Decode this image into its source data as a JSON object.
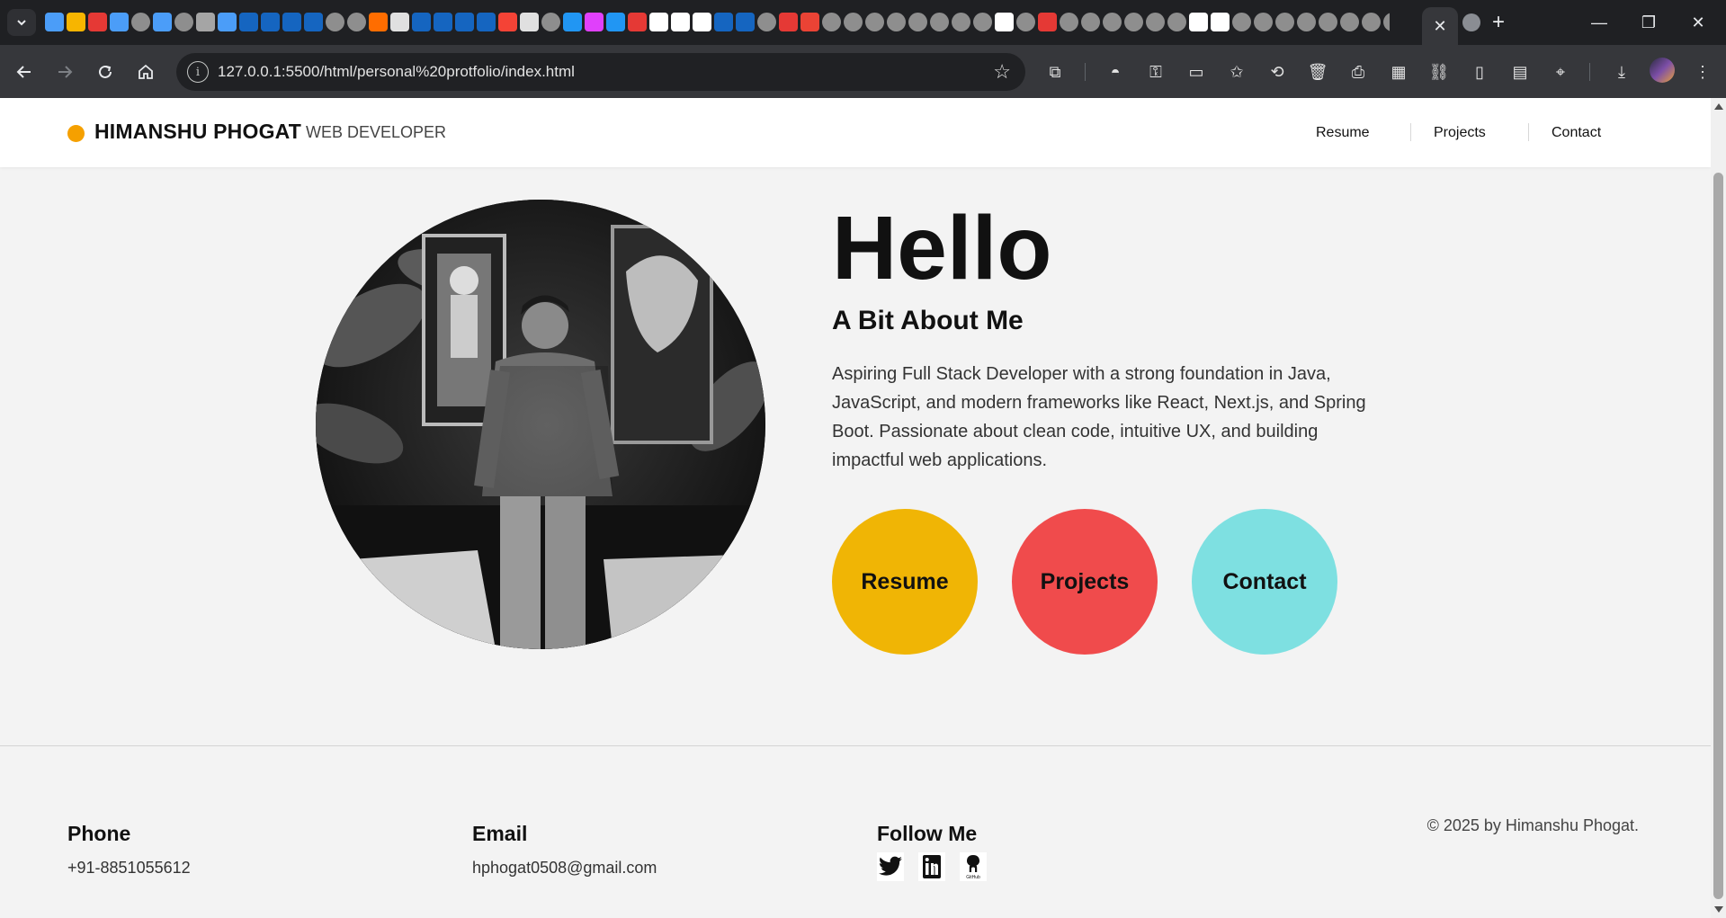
{
  "browser": {
    "tab_search_icon": "chevron-down",
    "active_tab_close": "✕",
    "new_tab": "+",
    "window": {
      "minimize": "—",
      "restore": "❐",
      "close": "✕"
    },
    "favicon_colors": [
      "#4b9df8",
      "#f7b500",
      "#e53935",
      "#4b9df8",
      "#8e8e8e",
      "#4b9df8",
      "#8e8e8e",
      "#a5a5a5",
      "#4b9df8",
      "#1565c0",
      "#1565c0",
      "#1565c0",
      "#1565c0",
      "#8e8e8e",
      "#8e8e8e",
      "#ff6d00",
      "#e0e0e0",
      "#1565c0",
      "#1565c0",
      "#1565c0",
      "#1565c0",
      "#f44336",
      "#e0e0e0",
      "#8e8e8e",
      "#2196f3",
      "#e040fb",
      "#2196f3",
      "#e53935",
      "#ffffff",
      "#ffffff",
      "#ffffff",
      "#1565c0",
      "#1565c0",
      "#8e8e8e",
      "#e53935",
      "#ea4335",
      "#8e8e8e",
      "#8e8e8e",
      "#8e8e8e",
      "#8e8e8e",
      "#8e8e8e",
      "#8e8e8e",
      "#8e8e8e",
      "#8e8e8e",
      "#ffffff",
      "#8e8e8e",
      "#e53935",
      "#8e8e8e",
      "#8e8e8e",
      "#8e8e8e",
      "#8e8e8e",
      "#8e8e8e",
      "#8e8e8e",
      "#ffffff",
      "#ffffff",
      "#8e8e8e",
      "#8e8e8e",
      "#8e8e8e",
      "#8e8e8e",
      "#8e8e8e",
      "#8e8e8e",
      "#8e8e8e",
      "#8e8e8e",
      "#8e8e8e",
      "#8e8e8e",
      "#8e8e8e",
      "#8e8e8e",
      "#8e8e8e",
      "#8e8e8e",
      "#1565c0",
      "#1565c0",
      "#e0e0e0",
      "#8e8e8e",
      "#ff7043",
      "#ff5722",
      "#ff7043",
      "#26a69a",
      "#8e8e8e"
    ],
    "address": {
      "url": "127.0.0.1:5500/html/personal%20protfolio/index.html"
    }
  },
  "site": {
    "header": {
      "brand_dot_color": "#f5a000",
      "name": "HIMANSHU PHOGAT",
      "role": "WEB DEVELOPER",
      "nav": [
        "Resume",
        "Projects",
        "Contact"
      ]
    },
    "hero": {
      "title": "Hello",
      "subtitle": "A Bit About Me",
      "bio": "Aspiring Full Stack Developer with a strong foundation in Java, JavaScript, and modern frameworks like React, Next.js, and Spring Boot. Passionate about clean code, intuitive UX, and building impactful web applications.",
      "buttons": [
        {
          "label": "Resume",
          "color": "#f0b505"
        },
        {
          "label": "Projects",
          "color": "#f04b4c"
        },
        {
          "label": "Contact",
          "color": "#7ee0e1"
        }
      ]
    },
    "footer": {
      "phone_title": "Phone",
      "phone": "+91-8851055612",
      "email_title": "Email",
      "email": "hphogat0508@gmail.com",
      "follow_title": "Follow Me",
      "social_icons": [
        "twitter-icon",
        "linkedin-icon",
        "github-icon"
      ],
      "copyright": "© 2025 by Himanshu Phogat."
    }
  }
}
